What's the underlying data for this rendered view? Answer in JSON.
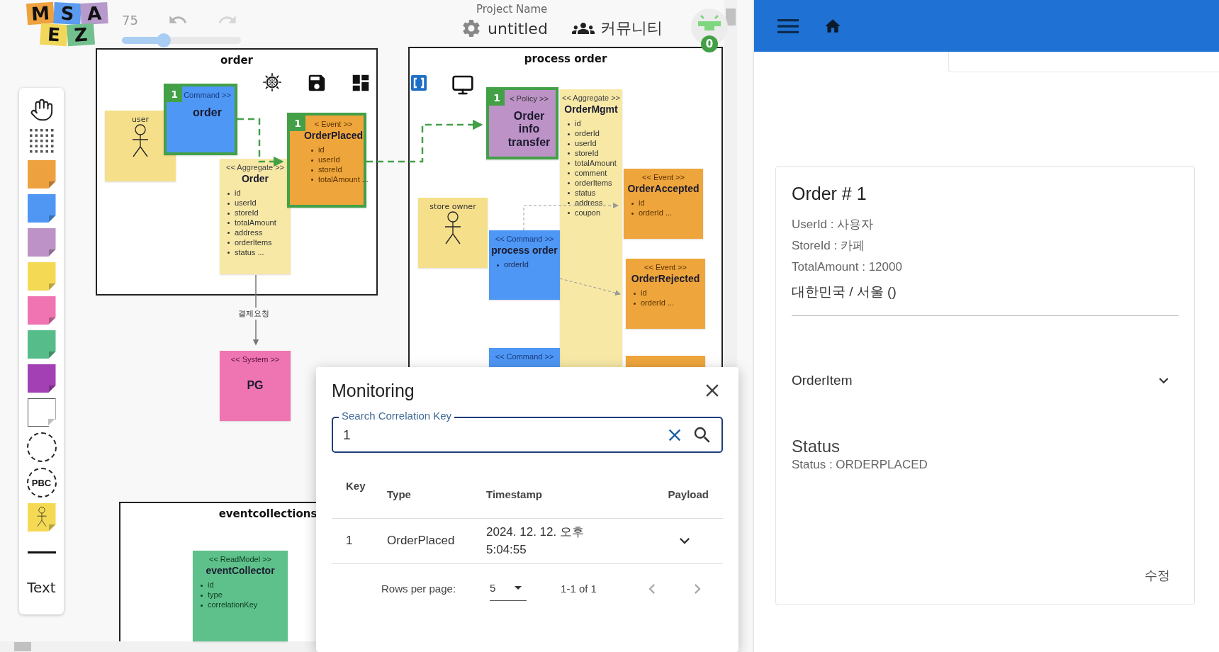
{
  "header": {
    "logo": [
      {
        "letter": "M",
        "color": "#eea13f"
      },
      {
        "letter": "S",
        "color": "#5b9bf0"
      },
      {
        "letter": "A",
        "color": "#b79acb"
      },
      {
        "letter": "E",
        "color": "#f2d85a"
      },
      {
        "letter": "Z",
        "color": "#72c08e"
      }
    ],
    "zoom": "75",
    "zoom_slider": {
      "level": 0.35
    },
    "project_label": "Project Name",
    "project_name": "untitled",
    "community": "커뮤니티",
    "notifications": "0"
  },
  "toolbar": [
    {
      "kind": "hand"
    },
    {
      "kind": "grid"
    },
    {
      "kind": "sticky",
      "color": "#eea13f"
    },
    {
      "kind": "sticky",
      "color": "#4f97f3"
    },
    {
      "kind": "sticky",
      "color": "#bd92c6"
    },
    {
      "kind": "sticky",
      "color": "#f4da54"
    },
    {
      "kind": "sticky",
      "color": "#ef74b1"
    },
    {
      "kind": "sticky",
      "color": "#56bd8a"
    },
    {
      "kind": "sticky",
      "color": "#a341b4"
    },
    {
      "kind": "blank"
    },
    {
      "kind": "boundary"
    },
    {
      "kind": "pbc",
      "label": "PBC"
    },
    {
      "kind": "actor"
    },
    {
      "kind": "line"
    },
    {
      "kind": "text",
      "label": "Text"
    }
  ],
  "contexts": [
    {
      "name": "order",
      "nodes": [
        {
          "kind": "actor",
          "label": "user"
        },
        {
          "kind": "command",
          "stereotype": "Command >>",
          "title": "order",
          "badge": "1",
          "highlighted": true
        },
        {
          "kind": "aggregate",
          "stereotype": "<< Aggregate >>",
          "title": "Order",
          "highlighted": false,
          "fields": [
            "id",
            "userId",
            "storeId",
            "totalAmount",
            "address",
            "orderItems",
            "status ..."
          ]
        },
        {
          "kind": "event",
          "stereotype": "< Event >>",
          "title": "OrderPlaced",
          "badge": "1",
          "highlighted": true,
          "fields": [
            "id",
            "userId",
            "storeId",
            "totalAmount ..."
          ]
        }
      ]
    },
    {
      "name": "process order",
      "nodes": [
        {
          "kind": "policy",
          "stereotype": "< Policy >>",
          "title": "Order info transfer",
          "badge": "1",
          "highlighted": true
        },
        {
          "kind": "aggregate",
          "stereotype": "<< Aggregate >>",
          "title": "OrderMgmt",
          "highlighted": false,
          "fields": [
            "id",
            "orderId",
            "userId",
            "storeId",
            "totalAmount",
            "comment",
            "orderItems",
            "status",
            "address",
            "coupon"
          ]
        },
        {
          "kind": "event",
          "stereotype": "<< Event >>",
          "title": "OrderAccepted",
          "highlighted": false,
          "fields": [
            "id",
            "orderId ..."
          ]
        },
        {
          "kind": "actor",
          "label": "store owner"
        },
        {
          "kind": "command",
          "stereotype": "<< Command >>",
          "title": "process order",
          "highlighted": false,
          "fields": [
            "orderId"
          ]
        },
        {
          "kind": "event",
          "stereotype": "<< Event >>",
          "title": "OrderRejected",
          "highlighted": false,
          "fields": [
            "id",
            "orderId ..."
          ]
        },
        {
          "kind": "command",
          "stereotype": "<< Command >>",
          "highlighted": false
        },
        {
          "kind": "event",
          "highlighted": false
        }
      ]
    },
    {
      "name": "eventcollections",
      "nodes": [
        {
          "kind": "readmodel",
          "stereotype": "<< ReadModel >>",
          "title": "eventCollector",
          "highlighted": false,
          "fields": [
            "id",
            "type",
            "correlationKey"
          ]
        }
      ]
    }
  ],
  "outside_nodes": [
    {
      "kind": "system",
      "stereotype": "<< System >>",
      "title": "PG",
      "highlighted": false
    }
  ],
  "relation_label": "결제요청",
  "monitoring": {
    "title": "Monitoring",
    "search": {
      "label": "Search Correlation Key",
      "value": "1"
    },
    "columns": [
      "Key",
      "Type",
      "Timestamp",
      "Payload"
    ],
    "rows": [
      {
        "key": "1",
        "type": "OrderPlaced",
        "timestamp": "2024. 12. 12. 오후 5:04:55",
        "expanded": false
      }
    ],
    "rows_per_page_label": "Rows per page:",
    "rows_per_page": "5",
    "range": "1-1 of 1"
  },
  "order_card": {
    "title": "Order # 1",
    "lines": [
      "UserId : 사용자",
      "StoreId : 카페",
      "TotalAmount : 12000"
    ],
    "address": "대한민국 / 서울 ()",
    "section": {
      "label": "OrderItem",
      "expanded": false
    },
    "status_heading": "Status",
    "status_line": "Status : ORDERPLACED",
    "edit": "수정"
  }
}
